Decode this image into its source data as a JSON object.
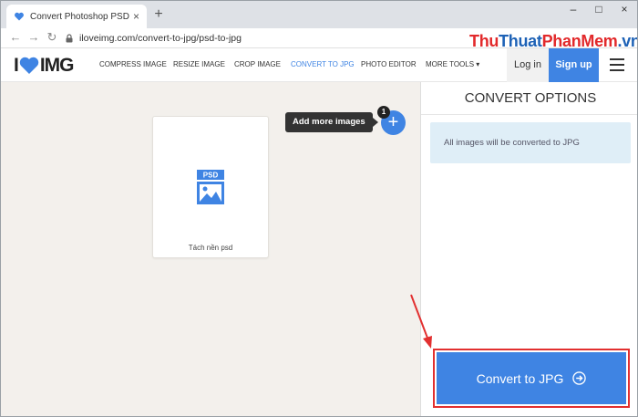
{
  "browser": {
    "tab_title": "Convert Photoshop PSD to JPG",
    "tab_close": "×",
    "new_tab": "+",
    "window_controls": [
      "–",
      "□",
      "×"
    ],
    "url": "iloveimg.com/convert-to-jpg/psd-to-jpg",
    "nav": {
      "back": "←",
      "forward": "→",
      "reload": "↻"
    }
  },
  "watermark": {
    "part1": "Thu",
    "part2": "Thuat",
    "part3": "PhanMem",
    "tld": ".vn"
  },
  "site": {
    "logo_left": "I",
    "logo_right": "IMG",
    "nav_items": [
      {
        "label": "COMPRESS IMAGE",
        "active": false
      },
      {
        "label": "RESIZE IMAGE",
        "active": false
      },
      {
        "label": "CROP IMAGE",
        "active": false
      },
      {
        "label": "CONVERT TO JPG",
        "active": true
      },
      {
        "label": "PHOTO EDITOR",
        "active": false
      },
      {
        "label": "MORE TOOLS ▾",
        "active": false
      }
    ],
    "login": "Log in",
    "signup": "Sign up",
    "accent_color": "#3f84e3"
  },
  "workspace": {
    "file": {
      "badge": "PSD",
      "name": "Tách nền psd"
    },
    "add_more_tooltip": "Add more images",
    "add_button": "+",
    "file_count": "1"
  },
  "panel": {
    "title": "CONVERT OPTIONS",
    "info": "All images will be converted to JPG",
    "convert_label": "Convert to JPG"
  }
}
